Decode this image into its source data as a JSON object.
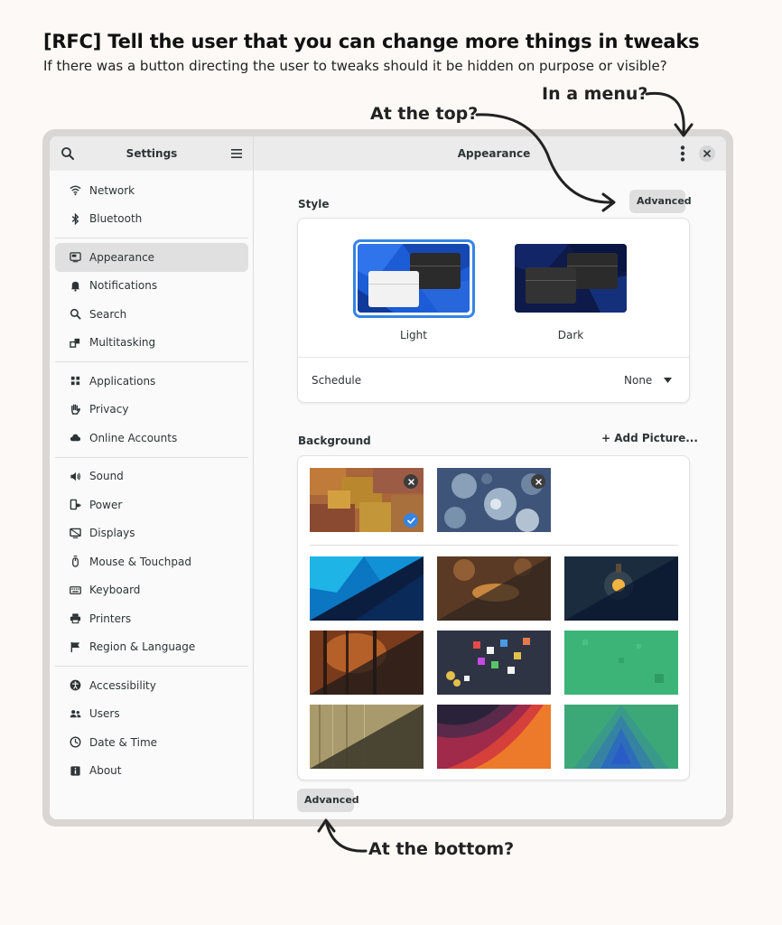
{
  "post": {
    "title": "[RFC] Tell the user that you can change more things in tweaks",
    "subtitle": "If there was a button directing the user to tweaks should it be hidden on purpose or visible?"
  },
  "annotations": {
    "menu": "In a menu?",
    "top": "At the top?",
    "bottom": "At the bottom?"
  },
  "sidebar": {
    "title": "Settings",
    "groups": [
      [
        {
          "label": "Network",
          "icon": "wifi-icon"
        },
        {
          "label": "Bluetooth",
          "icon": "bluetooth-icon"
        }
      ],
      [
        {
          "label": "Appearance",
          "icon": "appearance-icon",
          "active": true
        },
        {
          "label": "Notifications",
          "icon": "bell-icon"
        },
        {
          "label": "Search",
          "icon": "search-icon"
        },
        {
          "label": "Multitasking",
          "icon": "multitasking-icon"
        }
      ],
      [
        {
          "label": "Applications",
          "icon": "grid-icon"
        },
        {
          "label": "Privacy",
          "icon": "hand-icon"
        },
        {
          "label": "Online Accounts",
          "icon": "cloud-icon"
        }
      ],
      [
        {
          "label": "Sound",
          "icon": "speaker-icon"
        },
        {
          "label": "Power",
          "icon": "power-icon"
        },
        {
          "label": "Displays",
          "icon": "display-icon"
        },
        {
          "label": "Mouse & Touchpad",
          "icon": "mouse-icon"
        },
        {
          "label": "Keyboard",
          "icon": "keyboard-icon"
        },
        {
          "label": "Printers",
          "icon": "printer-icon"
        },
        {
          "label": "Region & Language",
          "icon": "flag-icon"
        }
      ],
      [
        {
          "label": "Accessibility",
          "icon": "accessibility-icon"
        },
        {
          "label": "Users",
          "icon": "users-icon"
        },
        {
          "label": "Date & Time",
          "icon": "clock-icon"
        },
        {
          "label": "About",
          "icon": "info-icon"
        }
      ]
    ]
  },
  "content": {
    "title": "Appearance",
    "advanced_top": "Advanced",
    "advanced_bottom": "Advanced",
    "style": {
      "label": "Style",
      "light": "Light",
      "dark": "Dark",
      "selected": "Light",
      "schedule_label": "Schedule",
      "schedule_value": "None"
    },
    "background": {
      "label": "Background",
      "add_picture": "+ Add Picture..."
    }
  },
  "colors": {
    "accent": "#3584e4",
    "window_bg": "#fafafa",
    "header_bg": "#ebebeb",
    "frame": "#d9d6d4"
  }
}
